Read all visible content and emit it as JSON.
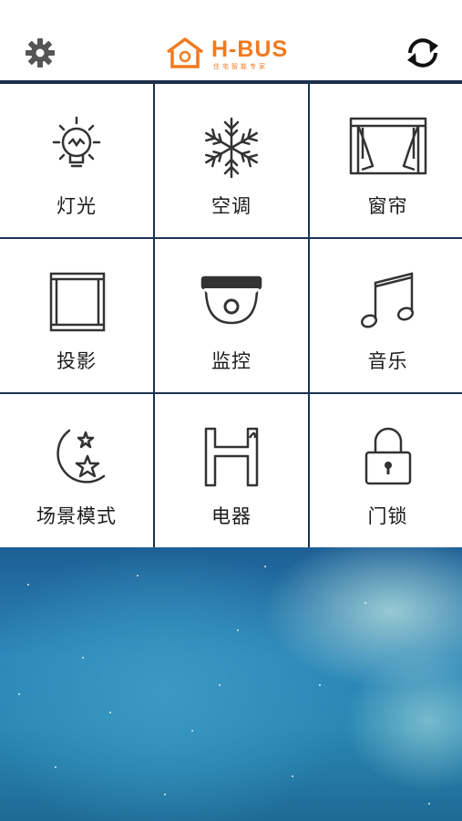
{
  "header": {
    "logo_text": "H-BUS",
    "logo_subtitle": "住宅智能专家"
  },
  "tiles": [
    {
      "label": "灯光",
      "icon": "light-bulb-icon"
    },
    {
      "label": "空调",
      "icon": "snowflake-icon"
    },
    {
      "label": "窗帘",
      "icon": "curtain-icon"
    },
    {
      "label": "投影",
      "icon": "projector-screen-icon"
    },
    {
      "label": "监控",
      "icon": "camera-icon"
    },
    {
      "label": "音乐",
      "icon": "music-note-icon"
    },
    {
      "label": "场景模式",
      "icon": "moon-stars-icon"
    },
    {
      "label": "电器",
      "icon": "appliance-icon"
    },
    {
      "label": "门锁",
      "icon": "lock-icon"
    }
  ],
  "colors": {
    "brand": "#f07a1f",
    "grid_line": "#1b3352",
    "icon_stroke": "#333333"
  }
}
